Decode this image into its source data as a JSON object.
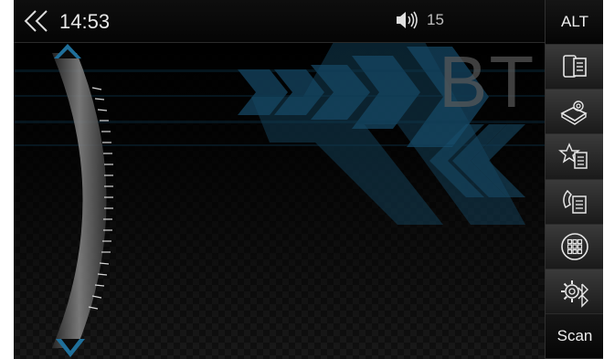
{
  "status": {
    "time": "14:53",
    "volume": "15"
  },
  "background": {
    "label": "BT"
  },
  "sidebar": {
    "top_label": "ALT",
    "bottom_label": "Scan",
    "icons": [
      "phone-list-icon",
      "phonebook-icon",
      "favorites-icon",
      "call-log-icon",
      "dialpad-icon",
      "bt-settings-icon"
    ]
  },
  "colors": {
    "accent_blue": "#1f6f9a",
    "background": "#000000"
  }
}
